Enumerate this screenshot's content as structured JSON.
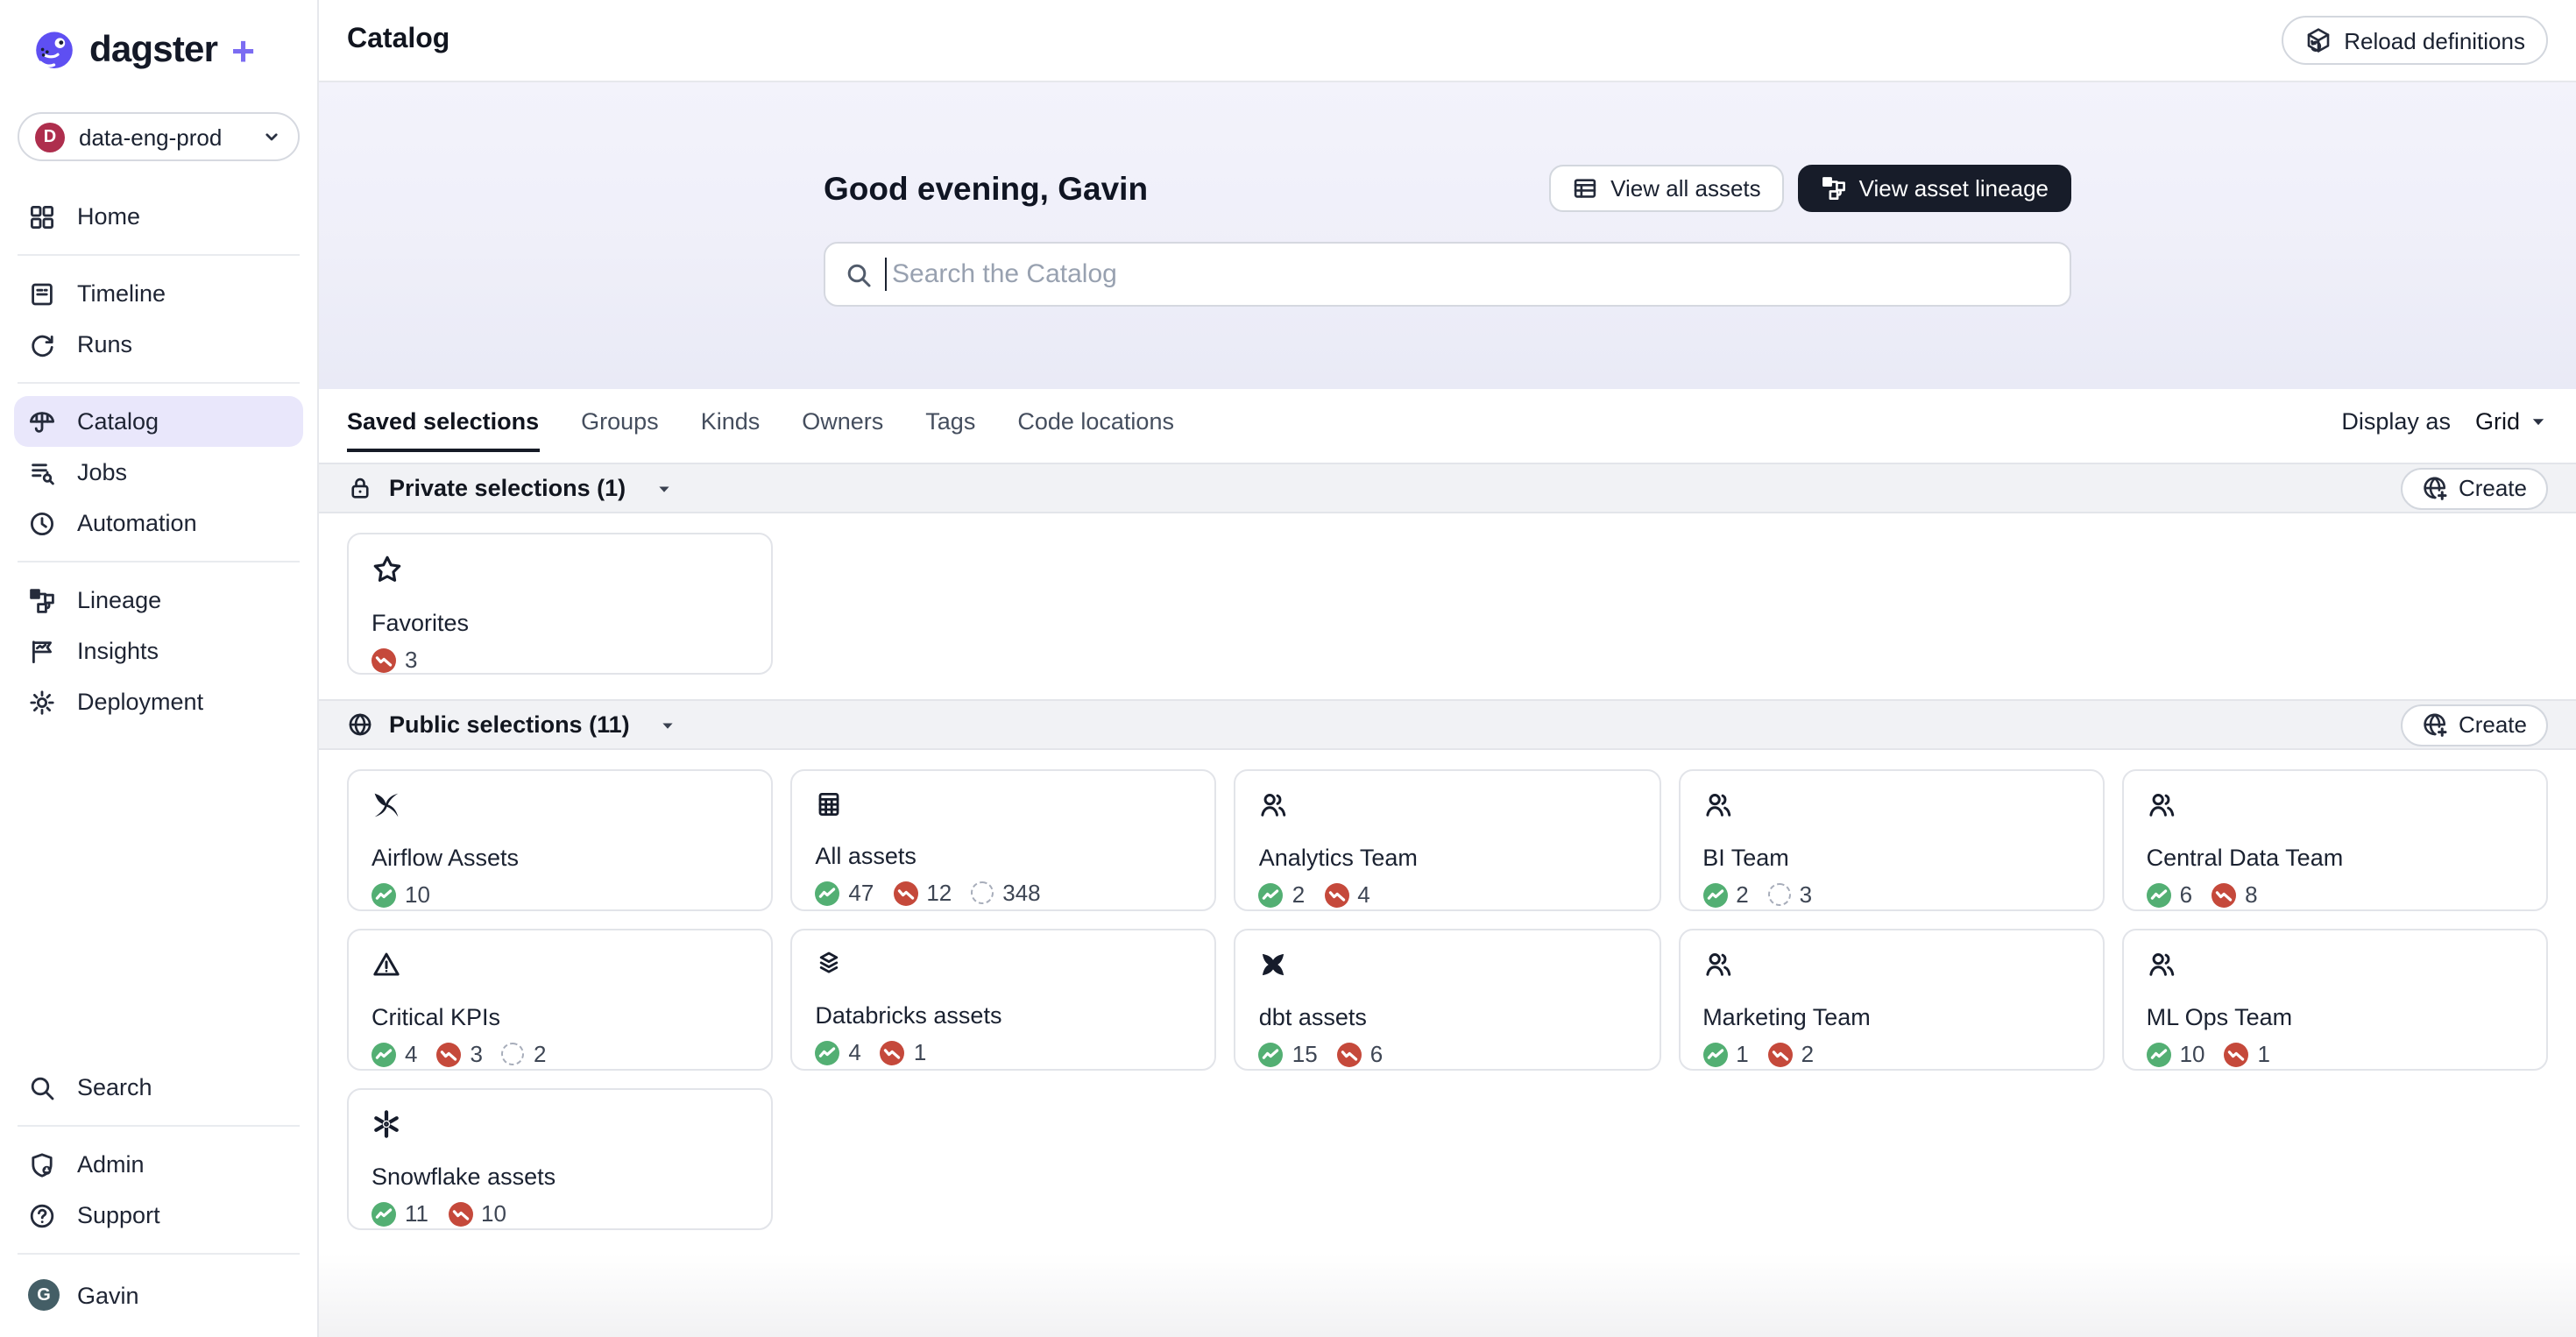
{
  "brand": {
    "name": "dagster",
    "plus": "+"
  },
  "workspace": {
    "avatar_initial": "D",
    "label": "data-eng-prod"
  },
  "sidebar": {
    "nav": [
      {
        "label": "Home",
        "icon": "home",
        "active": false,
        "divider_after": true
      },
      {
        "label": "Timeline",
        "icon": "timeline",
        "active": false,
        "divider_after": false
      },
      {
        "label": "Runs",
        "icon": "runs",
        "active": false,
        "divider_after": true
      },
      {
        "label": "Catalog",
        "icon": "catalog",
        "active": true,
        "divider_after": false
      },
      {
        "label": "Jobs",
        "icon": "jobs",
        "active": false,
        "divider_after": false
      },
      {
        "label": "Automation",
        "icon": "automation",
        "active": false,
        "divider_after": true
      },
      {
        "label": "Lineage",
        "icon": "lineage",
        "active": false,
        "divider_after": false
      },
      {
        "label": "Insights",
        "icon": "insights",
        "active": false,
        "divider_after": false
      },
      {
        "label": "Deployment",
        "icon": "deployment",
        "active": false,
        "divider_after": false
      }
    ],
    "footer": [
      {
        "label": "Search",
        "icon": "search",
        "divider_after": true
      },
      {
        "label": "Admin",
        "icon": "admin",
        "divider_after": false
      },
      {
        "label": "Support",
        "icon": "support",
        "divider_after": true
      }
    ],
    "user": {
      "name": "Gavin",
      "avatar_initial": "G"
    }
  },
  "header": {
    "title": "Catalog",
    "reload_label": "Reload definitions"
  },
  "hero": {
    "greeting": "Good evening, Gavin",
    "view_all_assets_label": "View all assets",
    "view_asset_lineage_label": "View asset lineage",
    "search_placeholder": "Search the Catalog"
  },
  "tabbar": {
    "tabs": [
      {
        "label": "Saved selections",
        "active": true
      },
      {
        "label": "Groups",
        "active": false
      },
      {
        "label": "Kinds",
        "active": false
      },
      {
        "label": "Owners",
        "active": false
      },
      {
        "label": "Tags",
        "active": false
      },
      {
        "label": "Code locations",
        "active": false
      }
    ],
    "display_as_label": "Display as",
    "display_as_value": "Grid"
  },
  "sections": [
    {
      "icon": "lock",
      "title": "Private selections (1)",
      "create_label": "Create",
      "cards": [
        {
          "icon": "star",
          "title": "Favorites",
          "counts": [
            {
              "type": "failed",
              "value": "3"
            }
          ]
        }
      ]
    },
    {
      "icon": "globe",
      "title": "Public selections (11)",
      "create_label": "Create",
      "cards": [
        {
          "icon": "airflow",
          "title": "Airflow Assets",
          "counts": [
            {
              "type": "success",
              "value": "10"
            }
          ]
        },
        {
          "icon": "table",
          "title": "All assets",
          "counts": [
            {
              "type": "success",
              "value": "47"
            },
            {
              "type": "failed",
              "value": "12"
            },
            {
              "type": "pending",
              "value": "348"
            }
          ]
        },
        {
          "icon": "people",
          "title": "Analytics Team",
          "counts": [
            {
              "type": "success",
              "value": "2"
            },
            {
              "type": "failed",
              "value": "4"
            }
          ]
        },
        {
          "icon": "people",
          "title": "BI Team",
          "counts": [
            {
              "type": "success",
              "value": "2"
            },
            {
              "type": "pending",
              "value": "3"
            }
          ]
        },
        {
          "icon": "people",
          "title": "Central Data Team",
          "counts": [
            {
              "type": "success",
              "value": "6"
            },
            {
              "type": "failed",
              "value": "8"
            }
          ]
        },
        {
          "icon": "warning",
          "title": "Critical KPIs",
          "counts": [
            {
              "type": "success",
              "value": "4"
            },
            {
              "type": "failed",
              "value": "3"
            },
            {
              "type": "pending",
              "value": "2"
            }
          ]
        },
        {
          "icon": "layers",
          "title": "Databricks assets",
          "counts": [
            {
              "type": "success",
              "value": "4"
            },
            {
              "type": "failed",
              "value": "1"
            }
          ]
        },
        {
          "icon": "dbt",
          "title": "dbt assets",
          "counts": [
            {
              "type": "success",
              "value": "15"
            },
            {
              "type": "failed",
              "value": "6"
            }
          ]
        },
        {
          "icon": "people",
          "title": "Marketing Team",
          "counts": [
            {
              "type": "success",
              "value": "1"
            },
            {
              "type": "failed",
              "value": "2"
            }
          ]
        },
        {
          "icon": "people",
          "title": "ML Ops Team",
          "counts": [
            {
              "type": "success",
              "value": "10"
            },
            {
              "type": "failed",
              "value": "1"
            }
          ]
        },
        {
          "icon": "snowflake",
          "title": "Snowflake assets",
          "counts": [
            {
              "type": "success",
              "value": "11"
            },
            {
              "type": "failed",
              "value": "10"
            }
          ]
        }
      ]
    }
  ],
  "colors": {
    "accent_purple": "#7B6CF2",
    "logo_purple": "#5E4FF2",
    "active_nav_bg": "#E9E7FB",
    "workspace_avatar": "#AE2E4D",
    "user_avatar": "#445E66",
    "dark_button_bg": "#171C29",
    "success_green": "#53AF73",
    "failed_red": "#C5493B",
    "hero_bg_top": "#F3F3FB",
    "hero_bg_bottom": "#E9EAF6"
  }
}
